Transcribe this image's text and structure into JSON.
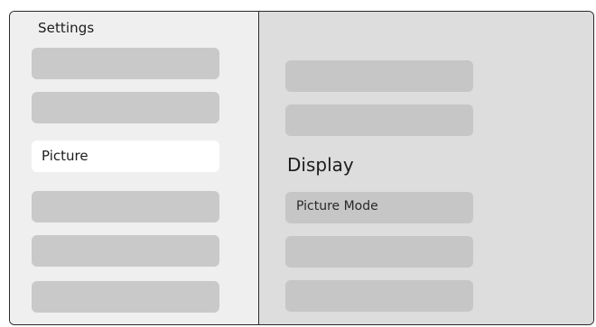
{
  "sidebar": {
    "title": "Settings",
    "items": [
      {
        "label": ""
      },
      {
        "label": ""
      },
      {
        "label": "Picture"
      },
      {
        "label": ""
      },
      {
        "label": ""
      },
      {
        "label": ""
      }
    ]
  },
  "main": {
    "heading": "Display",
    "items": [
      {
        "label": ""
      },
      {
        "label": ""
      },
      {
        "label": "Picture Mode"
      },
      {
        "label": ""
      },
      {
        "label": ""
      }
    ]
  }
}
